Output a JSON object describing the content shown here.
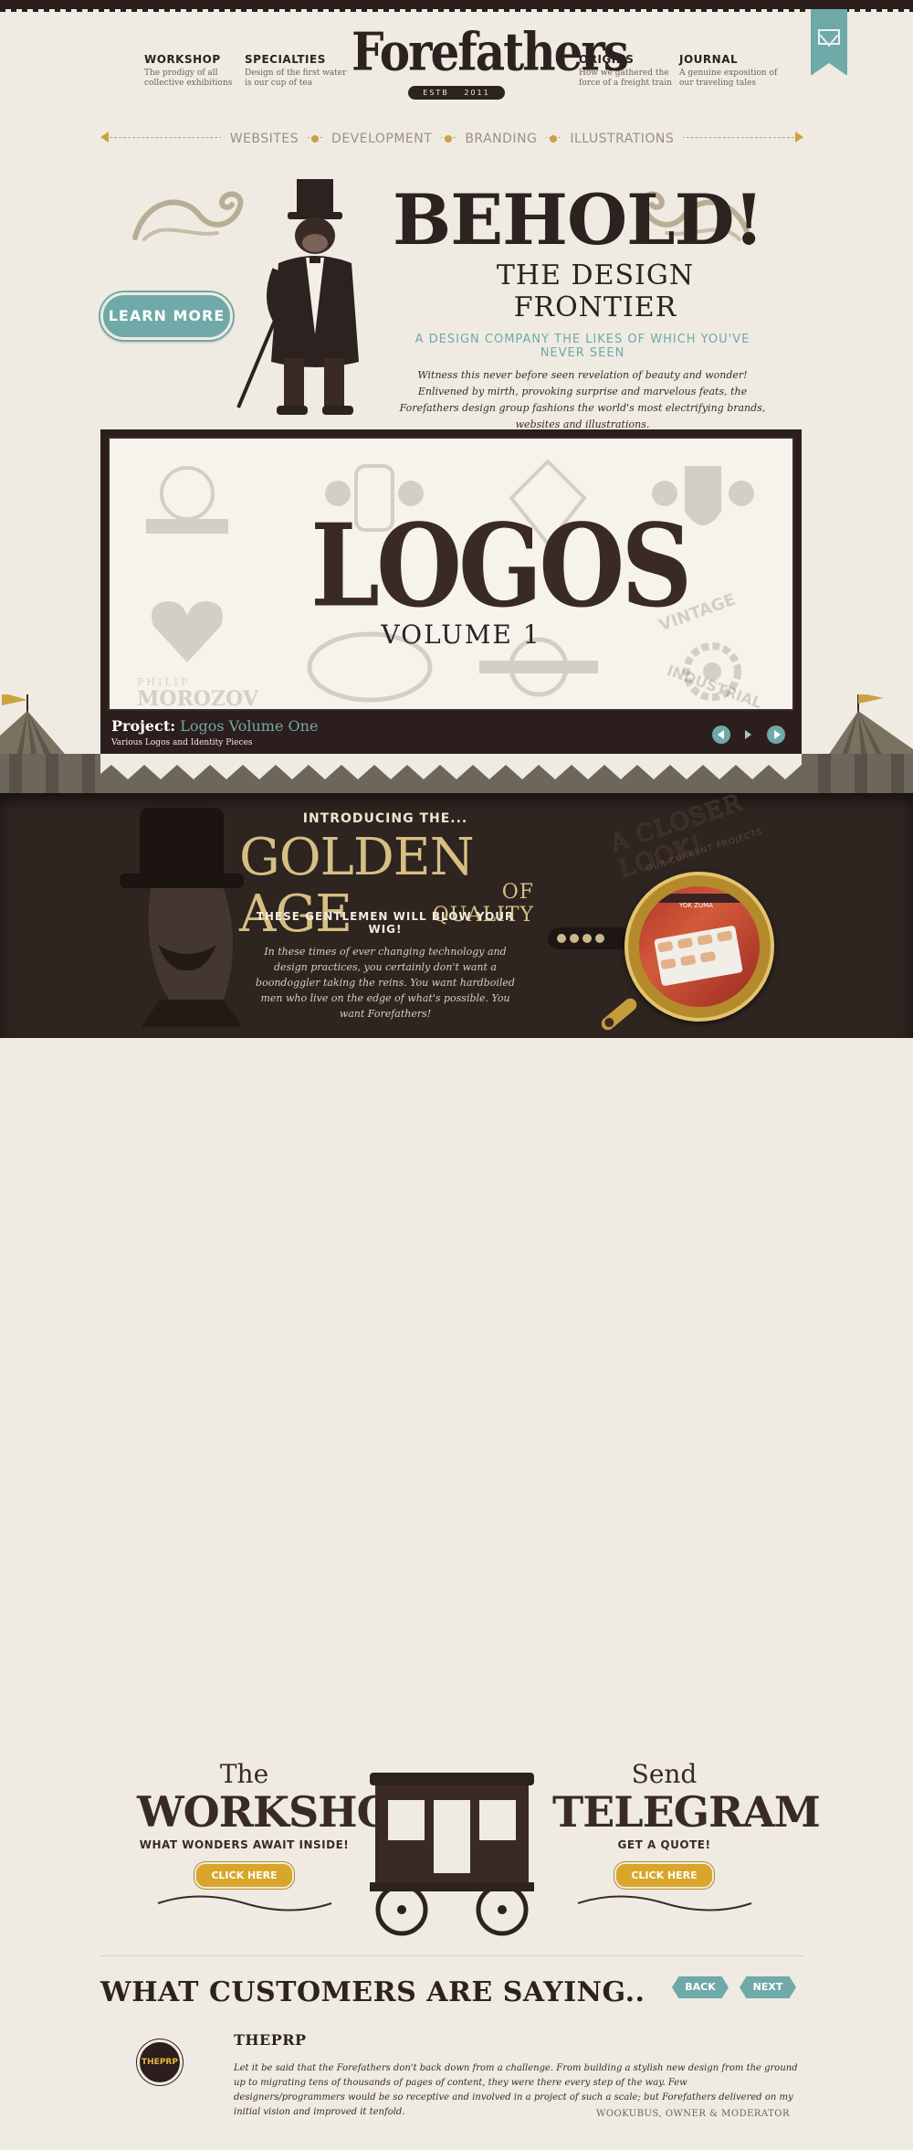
{
  "header": {
    "brand": "Forefathers",
    "estb": "ESTB",
    "year": "2011",
    "nav": [
      {
        "title": "WORKSHOP",
        "desc": "The prodigy of all collective exhibitions"
      },
      {
        "title": "SPECIALTIES",
        "desc": "Design of the first water is our cup of tea"
      },
      {
        "title": "ORIGINS",
        "desc": "How we gathered the force of a freight train"
      },
      {
        "title": "JOURNAL",
        "desc": "A genuine exposition of our traveling tales"
      }
    ],
    "subnav": [
      "WEBSITES",
      "DEVELOPMENT",
      "BRANDING",
      "ILLUSTRATIONS"
    ],
    "contact_icon": "envelope-icon"
  },
  "hero": {
    "headline": "BEHOLD!",
    "subheadline": "THE DESIGN FRONTIER",
    "tagline": "A DESIGN COMPANY THE LIKES OF WHICH YOU'VE NEVER SEEN",
    "body": "Witness this never before seen revelation of beauty and wonder! Enlivened by mirth, provoking surprise and marvelous feats, the Forefathers design group fashions the world's most electrifying brands, websites and illustrations.",
    "cta": "LEARN MORE"
  },
  "slider": {
    "title": "LOGOS",
    "subtitle": "VOLUME 1",
    "project_label": "Project:",
    "project_name": "Logos Volume One",
    "project_desc": "Various Logos and Identity Pieces",
    "ghost_text_1": "PHILIP",
    "ghost_text_2": "MOROZOV",
    "ghost_text_3": "VINTAGE",
    "ghost_text_4": "INDUSTRIAL"
  },
  "golden": {
    "intro": "INTRODUCING THE...",
    "title": "GOLDEN AGE",
    "title_sub": "OF QUALITY",
    "tagline": "THESE GENTLEMEN WILL BLOW YOUR WIG!",
    "body": "In these times of ever changing technology and design practices, you certainly don't want a boondoggler taking the reins. You want hardboiled men who live on the edge of what's possible. You want Forefathers!",
    "closer": "A CLOSER LOOK!",
    "closer_sub": "OUR CURRENT PROJECTS",
    "preview_label": "YOK ZUMA"
  },
  "ctas": {
    "workshop_small": "The",
    "workshop_big": "WORKSHOP",
    "workshop_tag": "WHAT WONDERS AWAIT INSIDE!",
    "workshop_btn": "CLICK HERE",
    "telegram_small": "Send",
    "telegram_big": "TELEGRAM",
    "telegram_tag": "GET A QUOTE!",
    "telegram_btn": "CLICK HERE"
  },
  "testimonials": {
    "title": "WHAT CUSTOMERS ARE SAYING..",
    "back": "BACK",
    "next": "NEXT",
    "name": "THEPRP",
    "avatar_label": "THEPRP",
    "quote": "Let it be said that the Forefathers don't back down from a challenge. From building a stylish new design from the ground up to migrating tens of thousands of pages of content, they were there every step of the way. Few designers/programmers would be so receptive and involved in a project of such a scale; but Forefathers delivered on my initial vision and improved it tenfold.",
    "author": "WOOKUBUS, OWNER & MODERATOR"
  },
  "colors": {
    "background": "#efebe2",
    "dark": "#2c2220",
    "teal": "#6fa9a8",
    "gold": "#caa340"
  }
}
